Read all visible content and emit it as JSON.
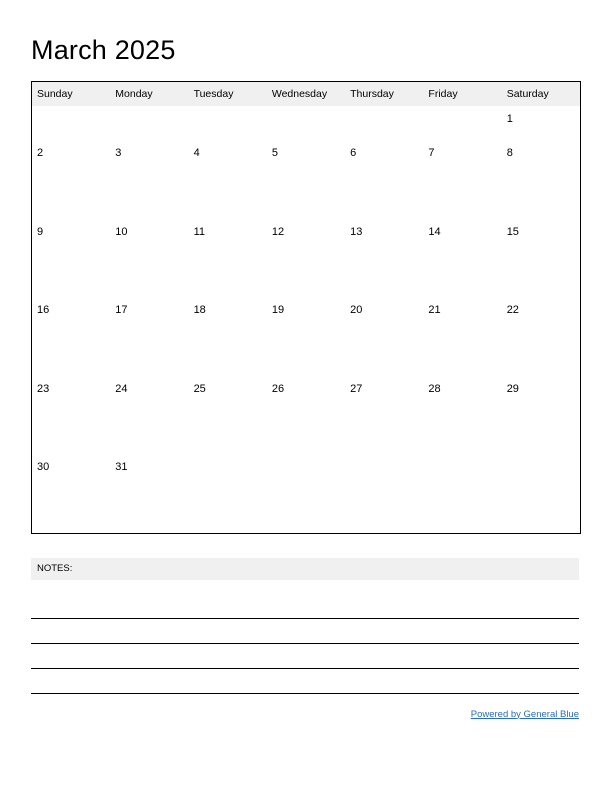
{
  "page_title": "March 2025",
  "calendar": {
    "month_label": "March 2025",
    "weekday_headers": [
      "Sunday",
      "Monday",
      "Tuesday",
      "Wednesday",
      "Thursday",
      "Friday",
      "Saturday"
    ],
    "weeks": [
      [
        "",
        "",
        "",
        "",
        "",
        "",
        "1"
      ],
      [
        "2",
        "3",
        "4",
        "5",
        "6",
        "7",
        "8"
      ],
      [
        "9",
        "10",
        "11",
        "12",
        "13",
        "14",
        "15"
      ],
      [
        "16",
        "17",
        "18",
        "19",
        "20",
        "21",
        "22"
      ],
      [
        "23",
        "24",
        "25",
        "26",
        "27",
        "28",
        "29"
      ],
      [
        "30",
        "31",
        "",
        "",
        "",
        "",
        ""
      ]
    ]
  },
  "notes": {
    "label": "NOTES:",
    "line_count": 4,
    "lines": [
      "",
      "",
      "",
      ""
    ]
  },
  "footer": {
    "link_text": "Powered by General Blue"
  },
  "colors": {
    "header_background": "#f0f0f0",
    "notes_background": "#f0f0f0",
    "grid_border": "#000000",
    "link": "#2a6ebb",
    "text": "#000000",
    "page_background": "#ffffff"
  }
}
